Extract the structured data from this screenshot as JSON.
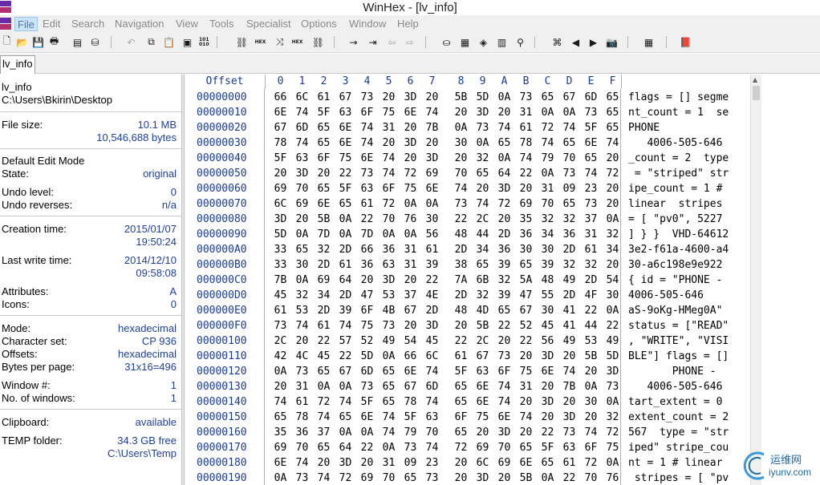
{
  "window": {
    "title": "WinHex - [lv_info]"
  },
  "menu": [
    "File",
    "Edit",
    "Search",
    "Navigation",
    "View",
    "Tools",
    "Specialist",
    "Options",
    "Window",
    "Help"
  ],
  "toolbar": {
    "icons": [
      "new-file-icon",
      "open-folder-icon",
      "save-icon",
      "print-icon",
      "properties-icon",
      "open-disk-icon",
      "undo-icon",
      "copy-icon",
      "paste-icon",
      "copy-hex-icon",
      "find-icon",
      "find-hex-icon",
      "replace-icon",
      "replace-hex-icon",
      "find-next-icon",
      "goto-offset-icon",
      "goto-sector-icon",
      "back-icon",
      "forward-icon",
      "disk-editor-icon",
      "ram-editor-icon",
      "analysis-icon",
      "calculator-icon",
      "search-icon",
      "snapshot-icon",
      "prev-icon",
      "next-icon",
      "camera-icon",
      "table-icon",
      "help-book-icon"
    ],
    "hex_small": [
      "HEX",
      "HEX",
      "101\n010"
    ]
  },
  "tabs": [
    {
      "label": "lv_info"
    }
  ],
  "info": {
    "file_name": "lv_info",
    "file_path": "C:\\Users\\Bkirin\\Desktop",
    "file_size_label": "File size:",
    "file_size_mb": "10.1 MB",
    "file_size_bytes": "10,546,688 bytes",
    "edit_mode": "Default Edit Mode",
    "state_label": "State:",
    "state_value": "original",
    "undo_level_label": "Undo level:",
    "undo_level_value": "0",
    "undo_reverses_label": "Undo reverses:",
    "undo_reverses_value": "n/a",
    "creation_time_label": "Creation time:",
    "creation_date": "2015/01/07",
    "creation_clock": "19:50:24",
    "last_write_label": "Last write time:",
    "last_write_date": "2014/12/10",
    "last_write_clock": "09:58:08",
    "attributes_label": "Attributes:",
    "attributes_value": "A",
    "icons_label": "Icons:",
    "icons_value": "0",
    "mode_label": "Mode:",
    "mode_value": "hexadecimal",
    "charset_label": "Character set:",
    "charset_value": "CP 936",
    "offsets_label": "Offsets:",
    "offsets_value": "hexadecimal",
    "bpp_label": "Bytes per page:",
    "bpp_value": "31x16=496",
    "window_no_label": "Window #:",
    "window_no_value": "1",
    "num_windows_label": "No. of windows:",
    "num_windows_value": "1",
    "clipboard_label": "Clipboard:",
    "clipboard_value": "available",
    "temp_label": "TEMP folder:",
    "temp_free": "34.3 GB free",
    "temp_path": "C:\\Users\\Temp"
  },
  "hex": {
    "offset_header": "Offset",
    "columns": [
      "0",
      "1",
      "2",
      "3",
      "4",
      "5",
      "6",
      "7",
      "8",
      "9",
      "A",
      "B",
      "C",
      "D",
      "E",
      "F"
    ],
    "rows": [
      {
        "offset": "00000000",
        "bytes": [
          "66",
          "6C",
          "61",
          "67",
          "73",
          "20",
          "3D",
          "20",
          "5B",
          "5D",
          "0A",
          "73",
          "65",
          "67",
          "6D",
          "65"
        ],
        "ascii": "flags = [] segme"
      },
      {
        "offset": "00000010",
        "bytes": [
          "6E",
          "74",
          "5F",
          "63",
          "6F",
          "75",
          "6E",
          "74",
          "20",
          "3D",
          "20",
          "31",
          "0A",
          "0A",
          "73",
          "65"
        ],
        "ascii": "nt_count = 1  se"
      },
      {
        "offset": "00000020",
        "bytes": [
          "67",
          "6D",
          "65",
          "6E",
          "74",
          "31",
          "20",
          "7B",
          "0A",
          "73",
          "74",
          "61",
          "72",
          "74",
          "5F",
          "65"
        ],
        "ascii": "PHONE"
      },
      {
        "offset": "00000030",
        "bytes": [
          "78",
          "74",
          "65",
          "6E",
          "74",
          "20",
          "3D",
          "20",
          "30",
          "0A",
          "65",
          "78",
          "74",
          "65",
          "6E",
          "74"
        ],
        "ascii": "   4006-505-646"
      },
      {
        "offset": "00000040",
        "bytes": [
          "5F",
          "63",
          "6F",
          "75",
          "6E",
          "74",
          "20",
          "3D",
          "20",
          "32",
          "0A",
          "74",
          "79",
          "70",
          "65",
          "20"
        ],
        "ascii": "_count = 2  type"
      },
      {
        "offset": "00000050",
        "bytes": [
          "20",
          "3D",
          "20",
          "22",
          "73",
          "74",
          "72",
          "69",
          "70",
          "65",
          "64",
          "22",
          "0A",
          "73",
          "74",
          "72"
        ],
        "ascii": " = \"striped\" str"
      },
      {
        "offset": "00000060",
        "bytes": [
          "69",
          "70",
          "65",
          "5F",
          "63",
          "6F",
          "75",
          "6E",
          "74",
          "20",
          "3D",
          "20",
          "31",
          "09",
          "23",
          "20"
        ],
        "ascii": "ipe_count = 1 #"
      },
      {
        "offset": "00000070",
        "bytes": [
          "6C",
          "69",
          "6E",
          "65",
          "61",
          "72",
          "0A",
          "0A",
          "73",
          "74",
          "72",
          "69",
          "70",
          "65",
          "73",
          "20"
        ],
        "ascii": "linear  stripes"
      },
      {
        "offset": "00000080",
        "bytes": [
          "3D",
          "20",
          "5B",
          "0A",
          "22",
          "70",
          "76",
          "30",
          "22",
          "2C",
          "20",
          "35",
          "32",
          "32",
          "37",
          "0A"
        ],
        "ascii": "= [ \"pv0\", 5227"
      },
      {
        "offset": "00000090",
        "bytes": [
          "5D",
          "0A",
          "7D",
          "0A",
          "7D",
          "0A",
          "0A",
          "56",
          "48",
          "44",
          "2D",
          "36",
          "34",
          "36",
          "31",
          "32"
        ],
        "ascii": "] } }  VHD-64612"
      },
      {
        "offset": "000000A0",
        "bytes": [
          "33",
          "65",
          "32",
          "2D",
          "66",
          "36",
          "31",
          "61",
          "2D",
          "34",
          "36",
          "30",
          "30",
          "2D",
          "61",
          "34"
        ],
        "ascii": "3e2-f61a-4600-a4"
      },
      {
        "offset": "000000B0",
        "bytes": [
          "33",
          "30",
          "2D",
          "61",
          "36",
          "63",
          "31",
          "39",
          "38",
          "65",
          "39",
          "65",
          "39",
          "32",
          "32",
          "20"
        ],
        "ascii": "30-a6c198e9e922"
      },
      {
        "offset": "000000C0",
        "bytes": [
          "7B",
          "0A",
          "69",
          "64",
          "20",
          "3D",
          "20",
          "22",
          "7A",
          "6B",
          "32",
          "5A",
          "48",
          "49",
          "2D",
          "54"
        ],
        "ascii": "{ id = \"PHONE -"
      },
      {
        "offset": "000000D0",
        "bytes": [
          "45",
          "32",
          "34",
          "2D",
          "47",
          "53",
          "37",
          "4E",
          "2D",
          "32",
          "39",
          "47",
          "55",
          "2D",
          "4F",
          "30"
        ],
        "ascii": "4006-505-646"
      },
      {
        "offset": "000000E0",
        "bytes": [
          "61",
          "53",
          "2D",
          "39",
          "6F",
          "4B",
          "67",
          "2D",
          "48",
          "4D",
          "65",
          "67",
          "30",
          "41",
          "22",
          "0A"
        ],
        "ascii": "aS-9oKg-HMeg0A\""
      },
      {
        "offset": "000000F0",
        "bytes": [
          "73",
          "74",
          "61",
          "74",
          "75",
          "73",
          "20",
          "3D",
          "20",
          "5B",
          "22",
          "52",
          "45",
          "41",
          "44",
          "22"
        ],
        "ascii": "status = [\"READ\""
      },
      {
        "offset": "00000100",
        "bytes": [
          "2C",
          "20",
          "22",
          "57",
          "52",
          "49",
          "54",
          "45",
          "22",
          "2C",
          "20",
          "22",
          "56",
          "49",
          "53",
          "49"
        ],
        "ascii": ", \"WRITE\", \"VISI"
      },
      {
        "offset": "00000110",
        "bytes": [
          "42",
          "4C",
          "45",
          "22",
          "5D",
          "0A",
          "66",
          "6C",
          "61",
          "67",
          "73",
          "20",
          "3D",
          "20",
          "5B",
          "5D"
        ],
        "ascii": "BLE\"] flags = []"
      },
      {
        "offset": "00000120",
        "bytes": [
          "0A",
          "73",
          "65",
          "67",
          "6D",
          "65",
          "6E",
          "74",
          "5F",
          "63",
          "6F",
          "75",
          "6E",
          "74",
          "20",
          "3D"
        ],
        "ascii": "       PHONE -"
      },
      {
        "offset": "00000130",
        "bytes": [
          "20",
          "31",
          "0A",
          "0A",
          "73",
          "65",
          "67",
          "6D",
          "65",
          "6E",
          "74",
          "31",
          "20",
          "7B",
          "0A",
          "73"
        ],
        "ascii": "   4006-505-646"
      },
      {
        "offset": "00000140",
        "bytes": [
          "74",
          "61",
          "72",
          "74",
          "5F",
          "65",
          "78",
          "74",
          "65",
          "6E",
          "74",
          "20",
          "3D",
          "20",
          "30",
          "0A"
        ],
        "ascii": "tart_extent = 0"
      },
      {
        "offset": "00000150",
        "bytes": [
          "65",
          "78",
          "74",
          "65",
          "6E",
          "74",
          "5F",
          "63",
          "6F",
          "75",
          "6E",
          "74",
          "20",
          "3D",
          "20",
          "32"
        ],
        "ascii": "extent_count = 2"
      },
      {
        "offset": "00000160",
        "bytes": [
          "35",
          "36",
          "37",
          "0A",
          "0A",
          "74",
          "79",
          "70",
          "65",
          "20",
          "3D",
          "20",
          "22",
          "73",
          "74",
          "72"
        ],
        "ascii": "567  type = \"str"
      },
      {
        "offset": "00000170",
        "bytes": [
          "69",
          "70",
          "65",
          "64",
          "22",
          "0A",
          "73",
          "74",
          "72",
          "69",
          "70",
          "65",
          "5F",
          "63",
          "6F",
          "75"
        ],
        "ascii": "iped\" stripe_cou"
      },
      {
        "offset": "00000180",
        "bytes": [
          "6E",
          "74",
          "20",
          "3D",
          "20",
          "31",
          "09",
          "23",
          "20",
          "6C",
          "69",
          "6E",
          "65",
          "61",
          "72",
          "0A"
        ],
        "ascii": "nt = 1 # linear"
      },
      {
        "offset": "00000190",
        "bytes": [
          "0A",
          "73",
          "74",
          "72",
          "69",
          "70",
          "65",
          "73",
          "20",
          "3D",
          "20",
          "5B",
          "0A",
          "22",
          "70",
          "76"
        ],
        "ascii": " stripes = [ \"pv"
      }
    ]
  },
  "watermark": {
    "cn": "运维网",
    "url": "iyunv.com"
  }
}
